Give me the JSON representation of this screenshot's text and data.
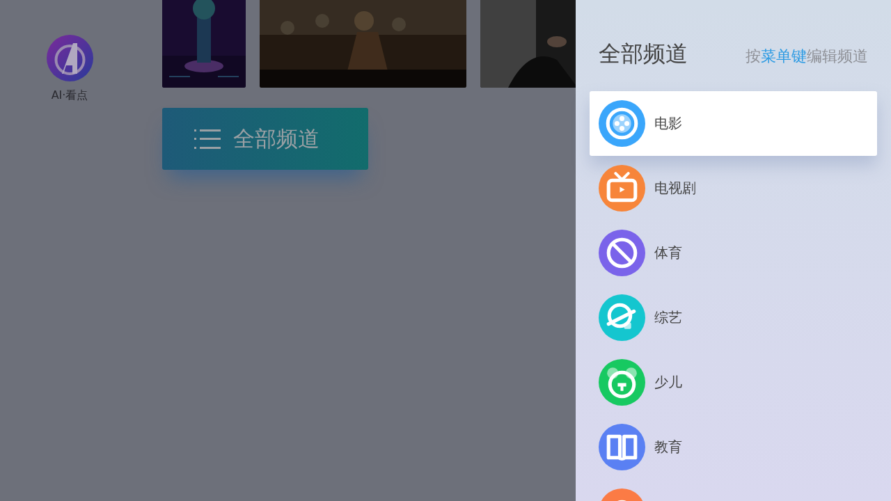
{
  "app_logo": {
    "label": "AI·看点"
  },
  "all_channels_button": {
    "label": "全部频道"
  },
  "panel": {
    "title": "全部频道",
    "hint": "按**菜单键**编辑频道",
    "channels": [
      {
        "kind": "film",
        "label": "电影",
        "color": "#3aa6fb",
        "selected": true
      },
      {
        "kind": "tv",
        "label": "电视剧",
        "color": "#f7853a",
        "selected": false
      },
      {
        "kind": "sports",
        "label": "体育",
        "color": "#7a63ea",
        "selected": false
      },
      {
        "kind": "variety",
        "label": "综艺",
        "color": "#14c6cf",
        "selected": false
      },
      {
        "kind": "kids",
        "label": "少儿",
        "color": "#17c961",
        "selected": false
      },
      {
        "kind": "education",
        "label": "教育",
        "color": "#5a80f3",
        "selected": false
      },
      {
        "kind": "other",
        "color": "#fb7b45",
        "selected": false
      }
    ]
  }
}
